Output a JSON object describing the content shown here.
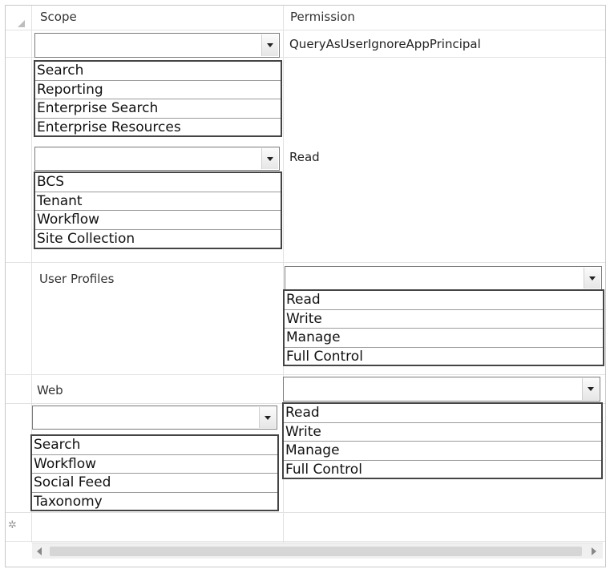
{
  "header": {
    "scope": "Scope",
    "permission": "Permission"
  },
  "rows": {
    "r1": {
      "permission_value": "QueryAsUserIgnoreAppPrincipal",
      "dropdown": [
        "Search",
        "Reporting",
        "Enterprise Search",
        "Enterprise Resources"
      ]
    },
    "r2": {
      "permission_value": "Read",
      "dropdown": [
        "BCS",
        "Tenant",
        "Workflow",
        "Site Collection"
      ]
    },
    "r3": {
      "scope_value": "User Profiles",
      "perm_dropdown": [
        "Read",
        "Write",
        "Manage",
        "Full Control"
      ]
    },
    "r4": {
      "scope_value": "Web",
      "perm_dropdown": [
        "Read",
        "Write",
        "Manage",
        "Full Control"
      ],
      "scope_dropdown": [
        "Search",
        "Workflow",
        "Social Feed",
        "Taxonomy"
      ]
    }
  },
  "icons": {
    "corner": "select-all-triangle-icon",
    "new_row": "new-row-star-icon"
  }
}
